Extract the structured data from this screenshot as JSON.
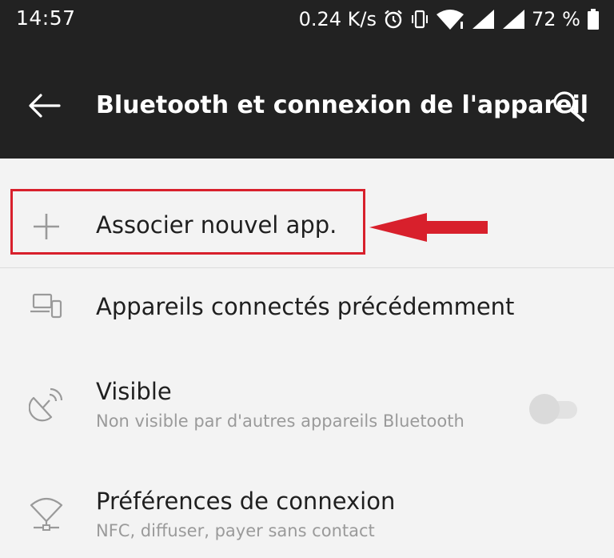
{
  "status_bar": {
    "time": "14:57",
    "net_speed": "0.24 K/s",
    "battery_percent": "72 %",
    "icons": [
      "alarm-icon",
      "vibrate-icon",
      "wifi-icon",
      "signal-icon",
      "signal-icon",
      "battery-icon"
    ]
  },
  "app_bar": {
    "title": "Bluetooth et connexion de l'appareil",
    "back_icon": "arrow-left-icon",
    "search_icon": "search-icon"
  },
  "list": {
    "pair_new": {
      "icon": "plus-icon",
      "label": "Associer nouvel app."
    },
    "previously_connected": {
      "icon": "devices-icon",
      "label": "Appareils connectés précédemment"
    },
    "visible": {
      "icon": "satellite-dish-icon",
      "label": "Visible",
      "subtitle": "Non visible par d'autres appareils Bluetooth",
      "toggle_on": false
    },
    "connection_prefs": {
      "icon": "connection-icon",
      "label": "Préférences de connexion",
      "subtitle": "NFC, diffuser, payer sans contact"
    }
  },
  "annotation": {
    "color": "#d8202c"
  },
  "colors": {
    "app_bar_bg": "#222222",
    "list_bg": "#f3f3f3",
    "primary_text": "#1f1f1f",
    "secondary_text": "#9a9a9a",
    "icon_gray": "#9a9a9a"
  }
}
